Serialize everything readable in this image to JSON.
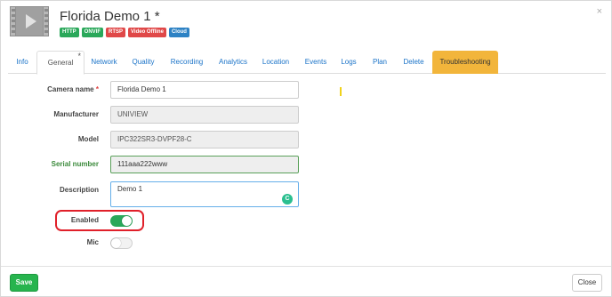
{
  "header": {
    "title": "Florida Demo 1 *",
    "thumbnail_icon": "video-play-icon",
    "close_icon": "×",
    "badges": [
      {
        "label": "HTTP",
        "color": "#2aa85a"
      },
      {
        "label": "ONVIF",
        "color": "#2aa85a"
      },
      {
        "label": "RTSP",
        "color": "#e04848"
      },
      {
        "label": "Video Offline",
        "color": "#e04848"
      },
      {
        "label": "Cloud",
        "color": "#2d82c4"
      }
    ]
  },
  "tabs": [
    {
      "label": "Info"
    },
    {
      "label": "General",
      "marker": "*"
    },
    {
      "label": "Network"
    },
    {
      "label": "Quality"
    },
    {
      "label": "Recording"
    },
    {
      "label": "Analytics"
    },
    {
      "label": "Location"
    },
    {
      "label": "Events"
    },
    {
      "label": "Logs"
    },
    {
      "label": "Plan"
    },
    {
      "label": "Delete"
    },
    {
      "label": "Troubleshooting"
    }
  ],
  "form": {
    "camera_name": {
      "label": "Camera name",
      "required_marker": "*",
      "value": "Florida Demo 1"
    },
    "manufacturer": {
      "label": "Manufacturer",
      "value": "UNIVIEW"
    },
    "model": {
      "label": "Model",
      "value": "IPC322SR3-DVPF28-C"
    },
    "serial_number": {
      "label": "Serial number",
      "value": "111aaa222www"
    },
    "description": {
      "label": "Description",
      "value": "Demo 1",
      "assist_icon": "C"
    },
    "enabled": {
      "label": "Enabled",
      "on": true
    },
    "mic": {
      "label": "Mic",
      "on": false
    }
  },
  "footer": {
    "save_label": "Save",
    "close_label": "Close"
  },
  "colors": {
    "accent_tab": "#f2b53b",
    "save": "#27b44e",
    "toggle_on": "#2aa85a",
    "annotation": "#e0202a"
  }
}
